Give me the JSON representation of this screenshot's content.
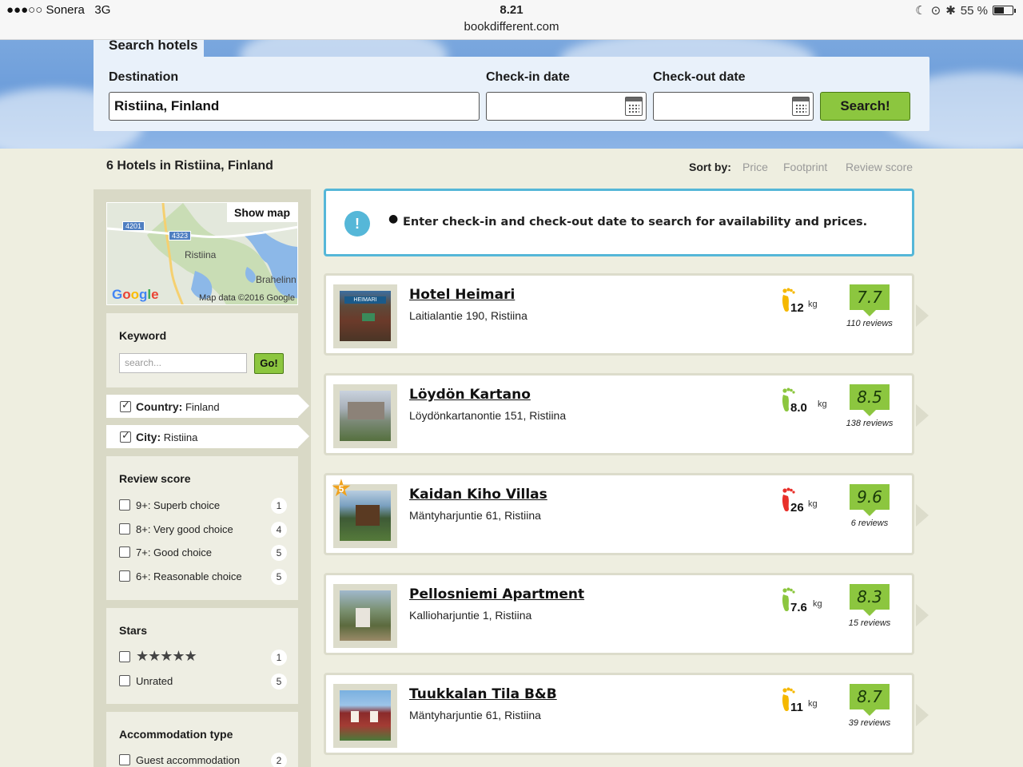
{
  "status": {
    "carrier": "●●●○○ Sonera",
    "network": "3G",
    "time": "8.21",
    "url": "bookdifferent.com",
    "battery": "55 %"
  },
  "search": {
    "tab_label": "Search hotels",
    "destination_label": "Destination",
    "destination_value": "Ristiina, Finland",
    "checkin_label": "Check-in date",
    "checkout_label": "Check-out date",
    "button": "Search!"
  },
  "results": {
    "count_text": "6 Hotels in Ristiina, Finland",
    "sort_label": "Sort by:",
    "sort_options": [
      "Price",
      "Footprint",
      "Review score"
    ]
  },
  "sidebar": {
    "map": {
      "button": "Show map",
      "copyright": "Map data ©2016 Google",
      "google": "Google",
      "roads": [
        "4201",
        "4323"
      ],
      "places": [
        "Ristiina",
        "Brahelinn"
      ]
    },
    "keyword": {
      "title": "Keyword",
      "placeholder": "search...",
      "button": "Go!"
    },
    "active_filters": [
      {
        "key": "Country:",
        "value": "Finland"
      },
      {
        "key": "City:",
        "value": "Ristiina"
      }
    ],
    "review_score": {
      "title": "Review score",
      "options": [
        {
          "label": "9+: Superb choice",
          "count": "1"
        },
        {
          "label": "8+: Very good choice",
          "count": "4"
        },
        {
          "label": "7+: Good choice",
          "count": "5"
        },
        {
          "label": "6+: Reasonable choice",
          "count": "5"
        }
      ]
    },
    "stars": {
      "title": "Stars",
      "options": [
        {
          "label": "★★★★★",
          "count": "1"
        },
        {
          "label": "Unrated",
          "count": "5"
        }
      ]
    },
    "accommodation": {
      "title": "Accommodation type",
      "options": [
        {
          "label": "Guest accommodation",
          "count": "2"
        }
      ]
    }
  },
  "notice": {
    "icon": "!",
    "text": "Enter check-in and check-out date to search for availability and prices."
  },
  "hotels": [
    {
      "name": "Hotel Heimari",
      "address": "Laitialantie 190, Ristiina",
      "footprint": "12",
      "unit": "kg",
      "footprint_color": "#f5b800",
      "score": "7.7",
      "reviews": "110 reviews"
    },
    {
      "name": "Löydön Kartano",
      "address": "Löydönkartanontie 151, Ristiina",
      "footprint": "8.0",
      "unit": "kg",
      "footprint_color": "#8cc63f",
      "score": "8.5",
      "reviews": "138 reviews"
    },
    {
      "name": "Kaidan Kiho Villas",
      "address": "Mäntyharjuntie 61, Ristiina",
      "footprint": "26",
      "unit": "kg",
      "footprint_color": "#e8302a",
      "score": "9.6",
      "reviews": "6 reviews",
      "star_badge": "5"
    },
    {
      "name": "Pellosniemi Apartment",
      "address": "Kallioharjuntie 1, Ristiina",
      "footprint": "7.6",
      "unit": "kg",
      "footprint_color": "#8cc63f",
      "score": "8.3",
      "reviews": "15 reviews"
    },
    {
      "name": "Tuukkalan Tila B&B",
      "address": "Mäntyharjuntie 61, Ristiina",
      "footprint": "11",
      "unit": "kg",
      "footprint_color": "#f5b800",
      "score": "8.7",
      "reviews": "39 reviews"
    }
  ]
}
